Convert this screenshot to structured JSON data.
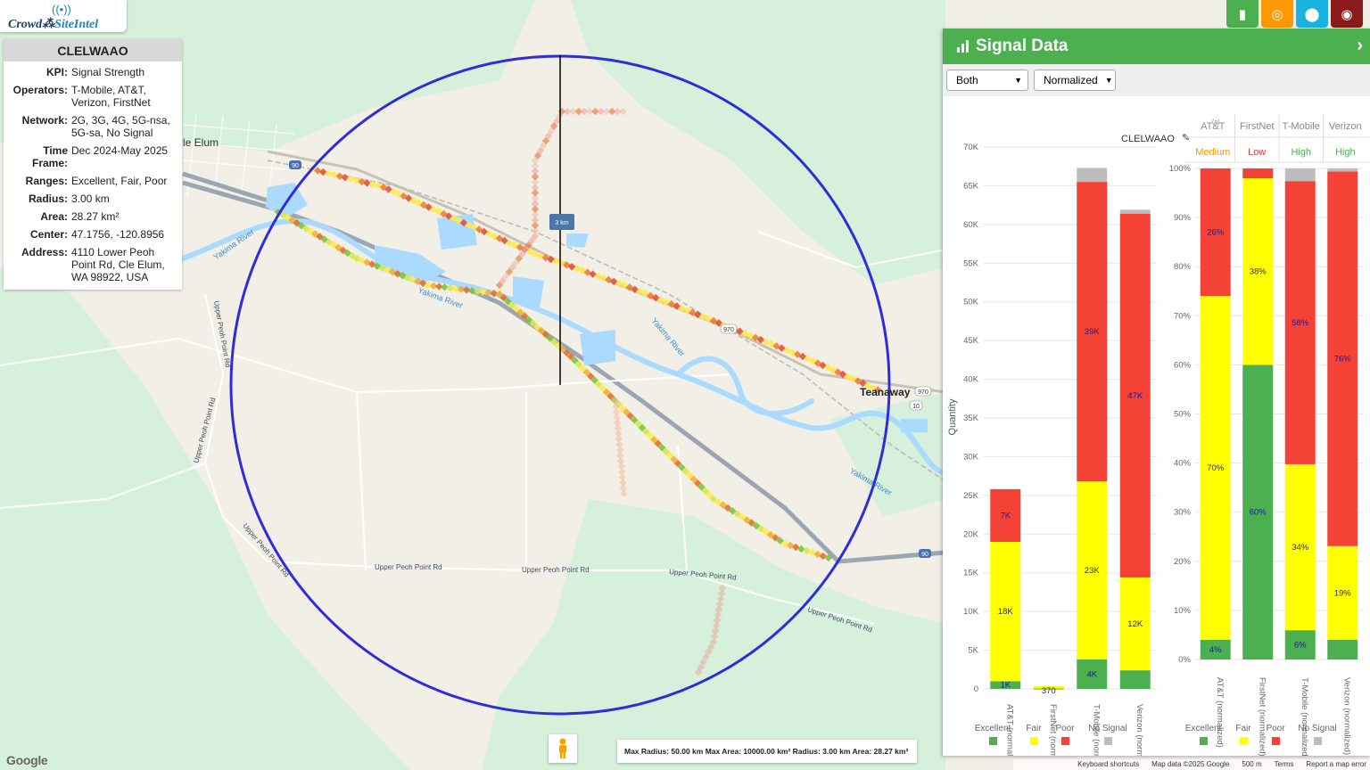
{
  "app": {
    "logo_prefix": "Crowd",
    "logo_suffix": "SiteIntel"
  },
  "info": {
    "title": "CLELWAAO",
    "rows": [
      {
        "k": "KPI:",
        "v": "Signal Strength"
      },
      {
        "k": "Operators:",
        "v": "T-Mobile, AT&T, Verizon, FirstNet"
      },
      {
        "k": "Network:",
        "v": "2G, 3G, 4G, 5G-nsa, 5G-sa, No Signal"
      },
      {
        "k": "Time Frame:",
        "v": "Dec 2024-May 2025"
      },
      {
        "k": "Ranges:",
        "v": "Excellent, Fair, Poor"
      },
      {
        "k": "Radius:",
        "v": "3.00 km"
      },
      {
        "k": "Area:",
        "v": "28.27 km²"
      },
      {
        "k": "Center:",
        "v": "47.1756, -120.8956"
      },
      {
        "k": "Address:",
        "v": "4110 Lower Peoh Point Rd, Cle Elum, WA 98922, USA"
      }
    ]
  },
  "toolbar": {
    "buttons": [
      {
        "name": "chart-icon",
        "color": "#4caf50",
        "glyph": "▮"
      },
      {
        "name": "target-icon",
        "color": "#ff9800",
        "glyph": "◎"
      },
      {
        "name": "location-pin-icon",
        "color": "#1ab3e0",
        "glyph": "⬤"
      },
      {
        "name": "globe-icon",
        "color": "#8b1a1a",
        "glyph": "◉"
      }
    ]
  },
  "map": {
    "labels": {
      "cle_elum": "le Elum",
      "teanaway": "Teanaway",
      "yakima1": "Yakima River",
      "yakima2": "Yakima River",
      "yakima3": "Yakima River",
      "yakima4": "Yakima River",
      "upper_peoh_v": "Upper Peoh Point Rd",
      "upper_peoh_v2": "Upper Peoh Point Rd",
      "upper_peoh_d": "Upper Peoh Point Rd",
      "upper_peoh_h1": "Upper Peoh Point Rd",
      "upper_peoh_h2": "Upper Peoh Point Rd",
      "upper_peoh_h3": "Upper Peoh Point Rd",
      "upper_peoh_e": "Upper Peoh Point Rd",
      "hw90a": "90",
      "hw90b": "90",
      "hw970a": "970",
      "hw970b": "970",
      "hw10": "10",
      "radius_tag": "3 km"
    },
    "status": "Max Radius: 50.00 km Max Area: 10000.00 km² Radius: 3.00 km Area: 28.27 km²",
    "footer": {
      "shortcuts": "Keyboard shortcuts",
      "mapdata": "Map data ©2025 Google",
      "scale": "500 m",
      "terms": "Terms",
      "report": "Report a map error"
    },
    "google": "Google"
  },
  "panel": {
    "title": "Signal Data",
    "operator_filter": "Both",
    "mode_filter": "Normalized",
    "site_label": "CLELWAAO",
    "operator_headers": [
      "AT&T",
      "FirstNet",
      "T-Mobile",
      "Verizon"
    ],
    "att_superscript": "(n)",
    "ranks": [
      {
        "label": "Medium",
        "color": "#ff9800"
      },
      {
        "label": "Low",
        "color": "#e53935"
      },
      {
        "label": "High",
        "color": "#4caf50"
      },
      {
        "label": "High",
        "color": "#4caf50"
      }
    ]
  },
  "chart_data": [
    {
      "type": "bar",
      "stacked": true,
      "title": "CLELWAAO",
      "ylabel": "Quantity",
      "ylim": [
        0,
        70000
      ],
      "yticks": [
        "0",
        "5K",
        "10K",
        "15K",
        "20K",
        "25K",
        "30K",
        "35K",
        "40K",
        "45K",
        "50K",
        "55K",
        "60K",
        "65K",
        "70K"
      ],
      "categories": [
        "AT&T (normalized)",
        "FirstNet (normalized)",
        "T-Mobile (normalized)",
        "Verizon (normalized)"
      ],
      "series": [
        {
          "name": "Excellent",
          "color": "#4caf50",
          "values": [
            1000,
            40,
            3800,
            2400
          ],
          "labels": [
            "1K",
            "",
            "4K",
            ""
          ]
        },
        {
          "name": "Fair",
          "color": "#ffff00",
          "values": [
            18000,
            330,
            23000,
            12000
          ],
          "labels": [
            "18K",
            "370",
            "23K",
            "12K"
          ]
        },
        {
          "name": "Poor",
          "color": "#f44336",
          "values": [
            6800,
            0,
            38700,
            47000
          ],
          "labels": [
            "7K",
            "",
            "39K",
            "47K"
          ]
        },
        {
          "name": "No Signal",
          "color": "#bdbdbd",
          "values": [
            0,
            0,
            1800,
            500
          ],
          "labels": [
            "",
            "",
            "",
            ""
          ]
        }
      ],
      "legend": [
        "Excellent",
        "Fair",
        "Poor",
        "No Signal"
      ]
    },
    {
      "type": "bar",
      "stacked": true,
      "ylim": [
        0,
        100
      ],
      "yticks": [
        "0%",
        "10%",
        "20%",
        "30%",
        "40%",
        "50%",
        "60%",
        "70%",
        "80%",
        "90%",
        "100%"
      ],
      "categories": [
        "AT&T (normalized)",
        "FirstNet (normalized)",
        "T-Mobile (normalized)",
        "Verizon (normalized)"
      ],
      "series": [
        {
          "name": "Excellent",
          "color": "#4caf50",
          "values": [
            4,
            60,
            6,
            4
          ],
          "labels": [
            "4%",
            "60%",
            "6%",
            ""
          ]
        },
        {
          "name": "Fair",
          "color": "#ffff00",
          "values": [
            70,
            38,
            34,
            19
          ],
          "labels": [
            "70%",
            "38%",
            "34%",
            "19%"
          ]
        },
        {
          "name": "Poor",
          "color": "#f44336",
          "values": [
            26,
            2,
            58,
            76
          ],
          "labels": [
            "26%",
            "",
            "58%",
            "76%"
          ]
        },
        {
          "name": "No Signal",
          "color": "#bdbdbd",
          "values": [
            0,
            0,
            2.6,
            0.6
          ],
          "labels": [
            "",
            "",
            "",
            ""
          ]
        }
      ],
      "legend": [
        "Excellent",
        "Fair",
        "Poor",
        "No Signal"
      ]
    }
  ]
}
